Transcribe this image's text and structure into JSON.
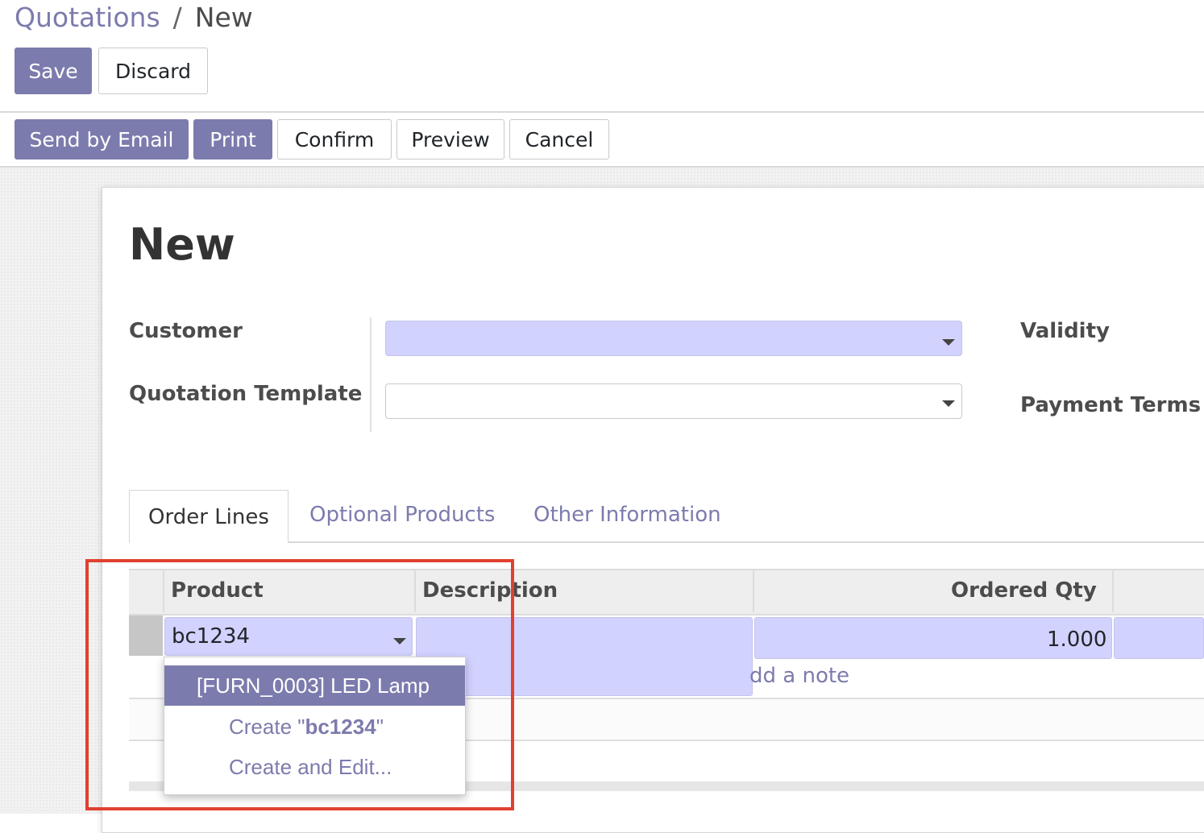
{
  "breadcrumb": {
    "parent": "Quotations",
    "separator": "/",
    "current": "New"
  },
  "toolbar": {
    "save_label": "Save",
    "discard_label": "Discard"
  },
  "status_bar": {
    "send_by_email_label": "Send by Email",
    "print_label": "Print",
    "confirm_label": "Confirm",
    "preview_label": "Preview",
    "cancel_label": "Cancel"
  },
  "form": {
    "title": "New",
    "customer_label": "Customer",
    "customer_value": "",
    "quotation_template_label": "Quotation Template",
    "quotation_template_value": "",
    "validity_label": "Validity",
    "payment_terms_label": "Payment Terms"
  },
  "tabs": [
    {
      "label": "Order Lines",
      "active": true
    },
    {
      "label": "Optional Products",
      "active": false
    },
    {
      "label": "Other Information",
      "active": false
    }
  ],
  "order_lines": {
    "columns": [
      "Product",
      "Description",
      "Ordered Qty"
    ],
    "rows": [
      {
        "product": "bc1234",
        "description": "",
        "ordered_qty": "1.000"
      }
    ],
    "add_note_label": "dd a note"
  },
  "product_dropdown": {
    "items": [
      {
        "label": "[FURN_0003] LED Lamp",
        "highlighted": true
      },
      {
        "prefix": "Create \"",
        "bold": "bc1234",
        "suffix": "\""
      },
      {
        "label": "Create and Edit..."
      }
    ]
  },
  "colors": {
    "primary": "#7c7bad",
    "required_field": "#d2d2ff",
    "highlight_box": "#e0412f"
  }
}
